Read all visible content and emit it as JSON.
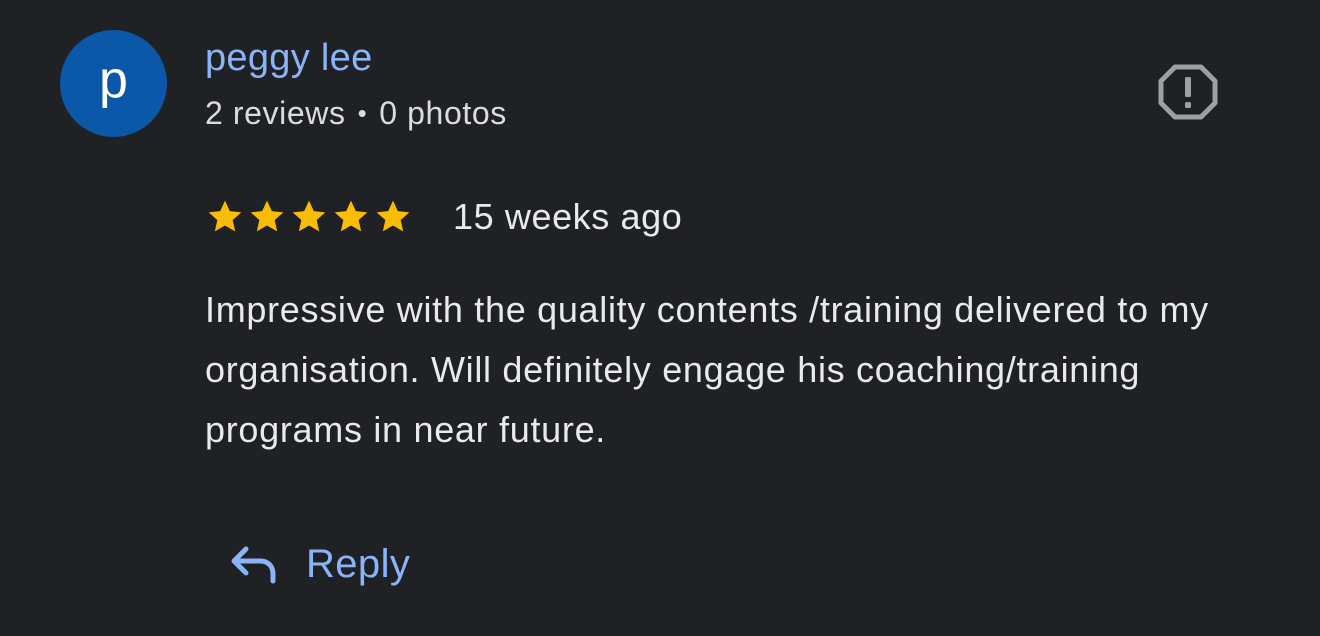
{
  "reviewer": {
    "avatar_letter": "p",
    "avatar_color": "#0b57a8",
    "name": "peggy lee",
    "reviews": "2 reviews",
    "separator": "•",
    "photos": "0 photos"
  },
  "report_icon": "report-octagon-icon",
  "rating": {
    "stars": 5,
    "max_stars": 5,
    "star_color": "#fbbc04",
    "time_ago": "15 weeks ago"
  },
  "review": {
    "text": "Impressive with the quality contents /training delivered to my organisation. Will definitely engage his coaching/training programs in near future."
  },
  "actions": {
    "reply_icon": "reply-arrow-icon",
    "reply_label": "Reply"
  },
  "colors": {
    "background": "#202124",
    "link": "#8ab4f8"
  }
}
